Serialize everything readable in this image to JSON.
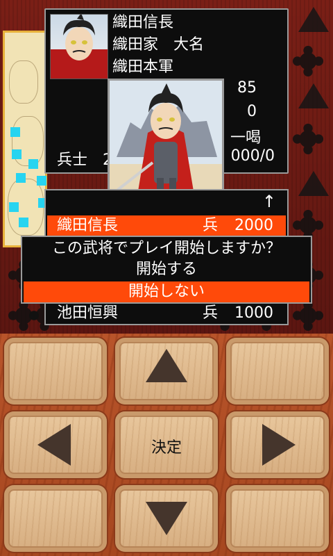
{
  "general": {
    "name": "織田信長",
    "house_rank": "織田家　大名",
    "army": "織田本軍",
    "stat1": "85",
    "stat2": "0",
    "stat3": "一喝",
    "troops_label": "兵士　2",
    "troops_value": "000/0"
  },
  "list": {
    "scroll_up": "↑",
    "rows": [
      {
        "name": "織田信長",
        "type": "兵",
        "count": "2000"
      },
      {
        "name": "池田恒興",
        "type": "兵",
        "count": "1000"
      }
    ]
  },
  "dialog": {
    "question": "この武将でプレイ開始しますか？",
    "option_start": "開始する",
    "option_cancel": "開始しない"
  },
  "controller": {
    "ok_label": "決定"
  },
  "colors": {
    "highlight": "#ff4a0a",
    "panel": "#0d0d0d",
    "marker": "#27d4f0"
  }
}
